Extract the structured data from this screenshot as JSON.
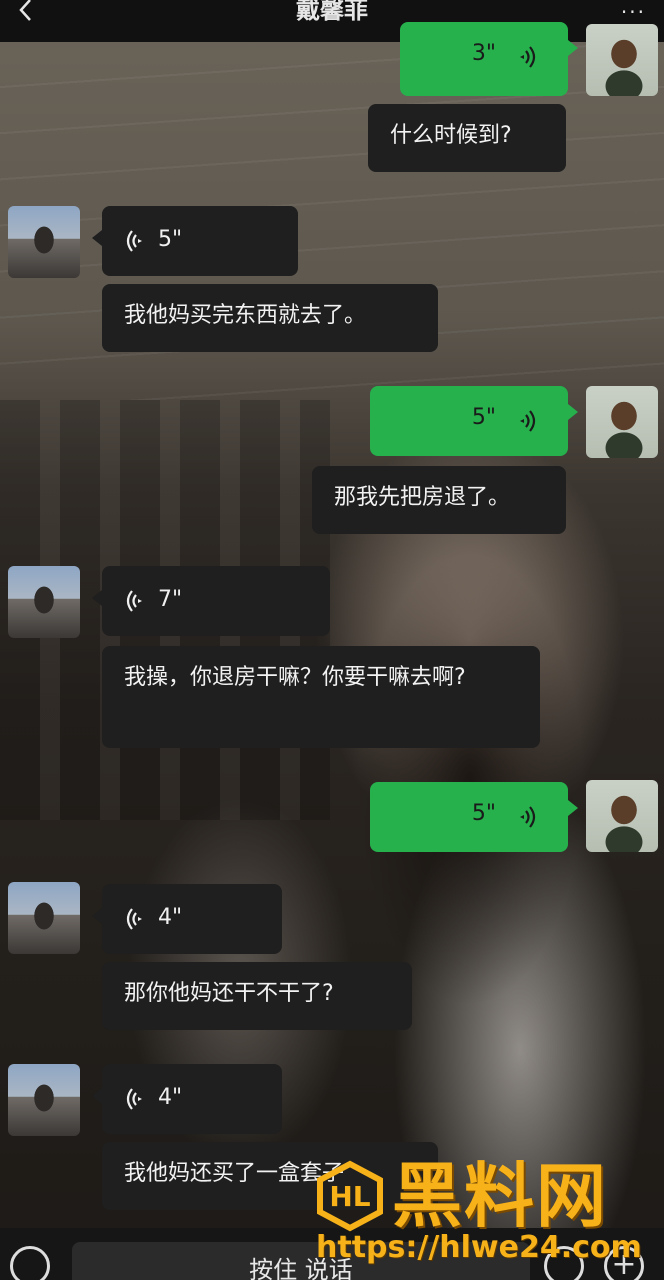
{
  "header": {
    "title": "戴馨菲",
    "more_label": "···"
  },
  "messages": [
    {
      "from": "self",
      "kind": "voice",
      "duration": "3\""
    },
    {
      "from": "self",
      "kind": "text",
      "text": "什么时候到?"
    },
    {
      "from": "friend",
      "kind": "voice",
      "duration": "5\""
    },
    {
      "from": "friend",
      "kind": "text",
      "text": "我他妈买完东西就去了。"
    },
    {
      "from": "self",
      "kind": "voice",
      "duration": "5\""
    },
    {
      "from": "self",
      "kind": "text",
      "text": "那我先把房退了。"
    },
    {
      "from": "friend",
      "kind": "voice",
      "duration": "7\""
    },
    {
      "from": "friend",
      "kind": "text",
      "text": "我操，你退房干嘛？你要干嘛去啊?"
    },
    {
      "from": "self",
      "kind": "voice",
      "duration": "5\""
    },
    {
      "from": "friend",
      "kind": "voice",
      "duration": "4\""
    },
    {
      "from": "friend",
      "kind": "text",
      "text": "那你他妈还干不干了?"
    },
    {
      "from": "friend",
      "kind": "voice",
      "duration": "4\""
    },
    {
      "from": "friend",
      "kind": "text",
      "text": "我他妈还买了一盒套子"
    }
  ],
  "input": {
    "hold_to_talk": "按住 说话"
  },
  "watermark": {
    "brand": "黑料网",
    "url": "https://hlwe24.com"
  },
  "colors": {
    "green_bubble": "#26b14d",
    "dark_bubble": "#1f1f1f",
    "watermark": "#f7b21a"
  }
}
